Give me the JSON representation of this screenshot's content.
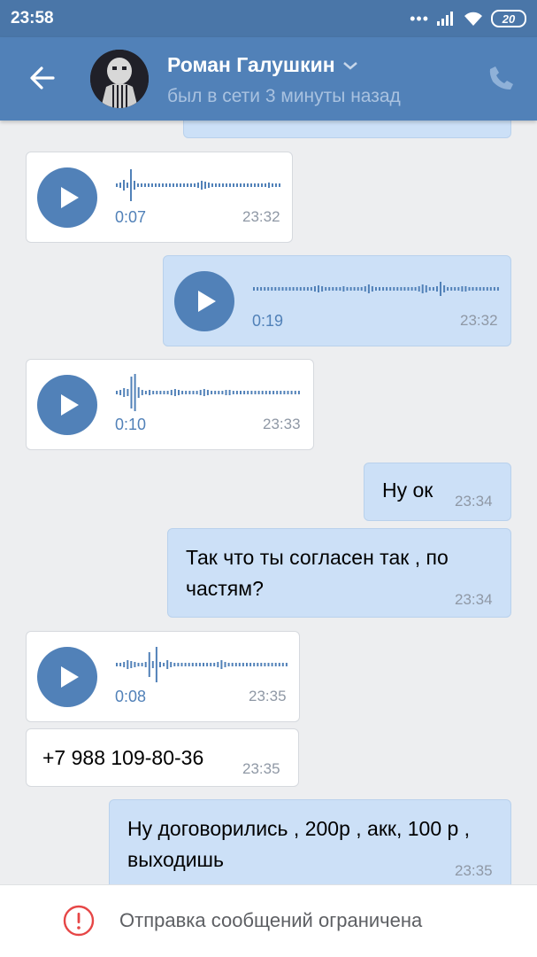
{
  "statusbar": {
    "time": "23:58",
    "battery": "20"
  },
  "header": {
    "name": "Роман Галушкин",
    "status": "был в сети 3 минуты назад"
  },
  "messages": [
    {
      "kind": "voice",
      "dir": "in",
      "duration": "0:07",
      "time": "23:32"
    },
    {
      "kind": "voice",
      "dir": "out",
      "duration": "0:19",
      "time": "23:32"
    },
    {
      "kind": "voice",
      "dir": "in",
      "duration": "0:10",
      "time": "23:33"
    },
    {
      "kind": "text",
      "dir": "out",
      "text": "Ну ок",
      "time": "23:34"
    },
    {
      "kind": "text",
      "dir": "out",
      "text": "Так что ты согласен так , по частям?",
      "time": "23:34"
    },
    {
      "kind": "voice",
      "dir": "in",
      "duration": "0:08",
      "time": "23:35"
    },
    {
      "kind": "text",
      "dir": "in",
      "text": "+7 988 109-80-36",
      "time": "23:35"
    },
    {
      "kind": "text",
      "dir": "out",
      "text": "Ну договорились , 200р , акк, 100 р , выходишь",
      "time": "23:35"
    }
  ],
  "footer": {
    "notice": "Отправка сообщений ограничена"
  },
  "colors": {
    "accent": "#5181b8",
    "outgoing_bubble": "#cce0f7",
    "incoming_bubble": "#ffffff"
  }
}
